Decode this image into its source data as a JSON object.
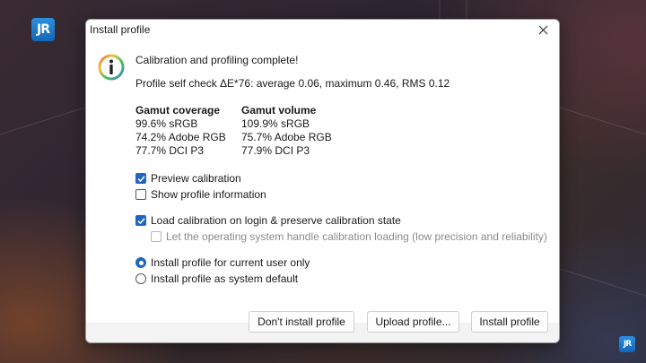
{
  "background": {
    "logo_text": "JR"
  },
  "dialog": {
    "title": "Install profile",
    "heading": "Calibration and profiling complete!",
    "self_check": "Profile self check ΔE*76: average 0.06, maximum 0.46, RMS 0.12",
    "gamut_coverage": {
      "header": "Gamut coverage",
      "values": [
        "99.6% sRGB",
        "74.2% Adobe RGB",
        "77.7% DCI P3"
      ]
    },
    "gamut_volume": {
      "header": "Gamut volume",
      "values": [
        "109.9% sRGB",
        "75.7% Adobe RGB",
        "77.9% DCI P3"
      ]
    },
    "options": {
      "preview_calibration": {
        "label": "Preview calibration",
        "checked": true
      },
      "show_profile_information": {
        "label": "Show profile information",
        "checked": false
      },
      "load_calibration": {
        "label": "Load calibration on login & preserve calibration state",
        "checked": true
      },
      "os_handle_calibration": {
        "label": "Let the operating system handle calibration loading (low precision and reliability)",
        "checked": false,
        "enabled": false
      },
      "install_current_user": {
        "label": "Install profile for current user only",
        "selected": true
      },
      "install_system_default": {
        "label": "Install profile as system default",
        "selected": false
      }
    },
    "buttons": {
      "dont_install": "Don't install profile",
      "upload": "Upload profile...",
      "install": "Install profile"
    }
  },
  "colors": {
    "accent": "#1f66c1",
    "dialog_background": "#ffffff",
    "footer_background": "#f0f0f0"
  }
}
